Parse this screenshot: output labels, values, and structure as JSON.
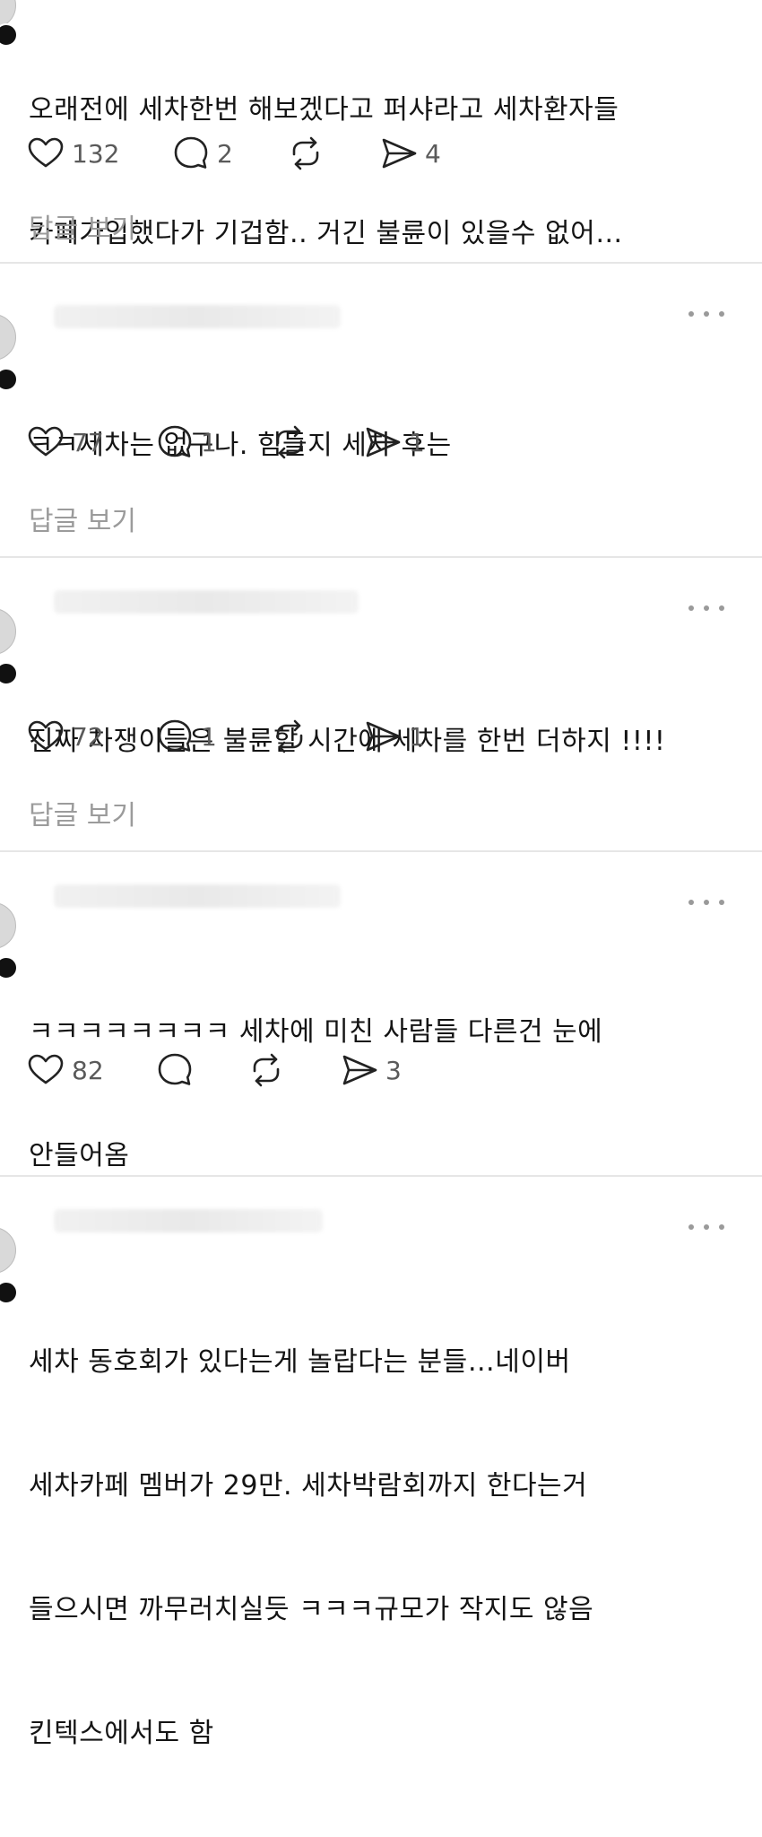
{
  "posts": [
    {
      "lines": [
        "오래전에 세차한번 해보겠다고 퍼샤라고 세차환자들",
        "카페가입했다가 기겁함.. 거긴 불륜이 있을수 없어…"
      ],
      "likes": "132",
      "comments": "2",
      "shares": "4",
      "view_replies": "답글 보기"
    },
    {
      "lines": [
        "ㅋㅋ세차는 없구나. 힘들지 세차 후는"
      ],
      "likes": "77",
      "comments": "1",
      "shares": "1",
      "view_replies": "답글 보기"
    },
    {
      "lines": [
        "진짜 차쟁이들은 불륜할 시간에 세차를 한번 더하지 !!!!"
      ],
      "likes": "72",
      "comments": "1",
      "shares": "1",
      "view_replies": "답글 보기"
    },
    {
      "lines": [
        "ㅋㅋㅋㅋㅋㅋㅋㅋ 세차에 미친 사람들 다른건 눈에",
        "안들어옴"
      ],
      "likes": "82",
      "comments": "",
      "shares": "3"
    },
    {
      "lines": [
        "세차 동호회가 있다는게 놀랍다는 분들…네이버",
        "세차카페 멤버가 29만. 세차박람회까지 한다는거",
        "들으시면 까무러치실듯 ㅋㅋㅋ규모가 작지도 않음",
        "킨텍스에서도 함"
      ]
    }
  ],
  "icons": {
    "like": "heart-icon",
    "comment": "comment-bubble-icon",
    "repost": "repost-icon",
    "share": "send-icon",
    "more": "more-dots-icon"
  }
}
